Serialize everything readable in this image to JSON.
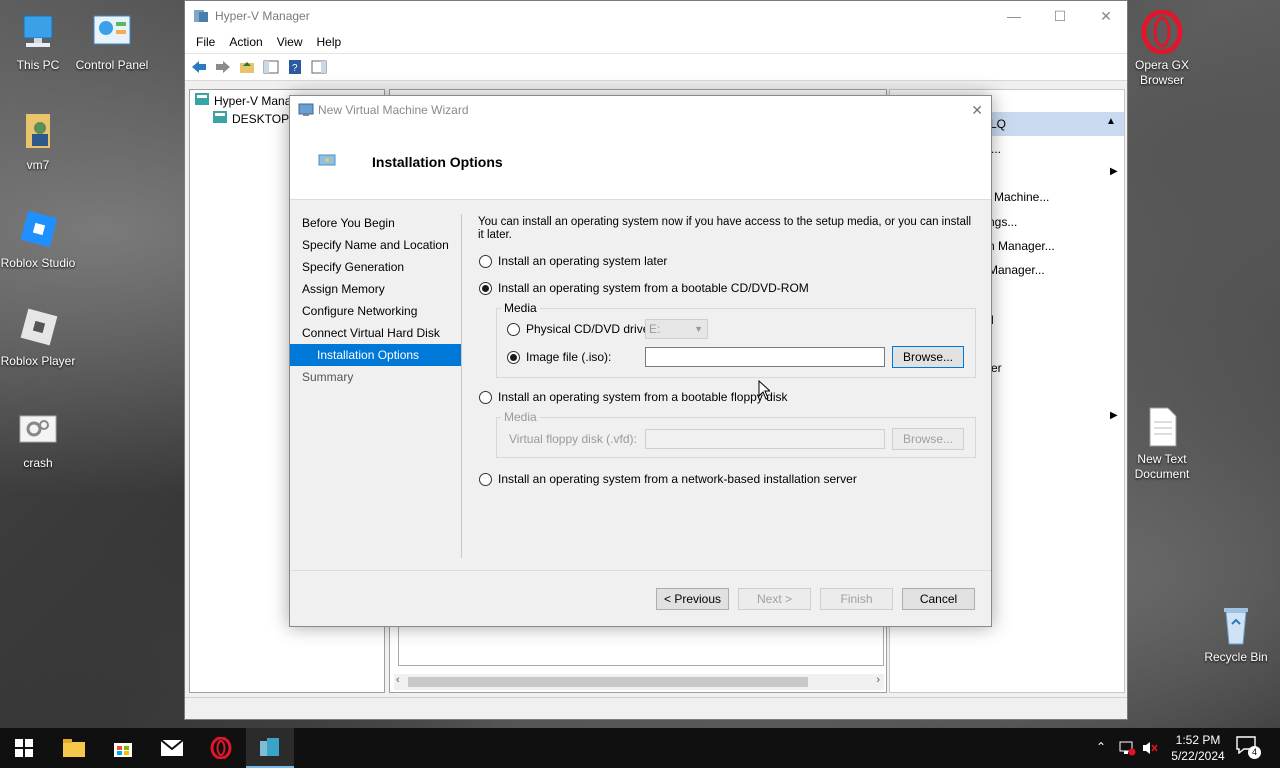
{
  "desktop": {
    "icons_left": [
      {
        "label": "This PC"
      },
      {
        "label": "Control Panel"
      },
      {
        "label": "vm7"
      },
      {
        "label": "Roblox Studio"
      },
      {
        "label": "Roblox Player"
      },
      {
        "label": "crash"
      }
    ],
    "icons_right": [
      {
        "label": "Opera GX Browser"
      },
      {
        "label": "New Text Document"
      },
      {
        "label": "Recycle Bin"
      }
    ]
  },
  "hyperv": {
    "title": "Hyper-V Manager",
    "menu": [
      "File",
      "Action",
      "View",
      "Help"
    ],
    "tree_root": "Hyper-V Mana",
    "tree_child": "DESKTOP-5",
    "actions_header": "LQ",
    "actions_items": [
      "...",
      "l Machine...",
      "ngs...",
      "n Manager...",
      "Manager...",
      "l",
      "er"
    ]
  },
  "wizard": {
    "title": "New Virtual Machine Wizard",
    "heading": "Installation Options",
    "nav": [
      "Before You Begin",
      "Specify Name and Location",
      "Specify Generation",
      "Assign Memory",
      "Configure Networking",
      "Connect Virtual Hard Disk",
      "Installation Options",
      "Summary"
    ],
    "intro": "You can install an operating system now if you have access to the setup media, or you can install it later.",
    "options": {
      "later": "Install an operating system later",
      "cd": "Install an operating system from a bootable CD/DVD-ROM",
      "floppy": "Install an operating system from a bootable floppy disk",
      "network": "Install an operating system from a network-based installation server"
    },
    "selected_option": "cd",
    "media_label": "Media",
    "physical_label": "Physical CD/DVD drive:",
    "physical_drive_value": "E:",
    "image_label": "Image file (.iso):",
    "image_value": "",
    "browse": "Browse...",
    "floppy_media_label": "Media",
    "floppy_label": "Virtual floppy disk (.vfd):",
    "floppy_value": "",
    "buttons": {
      "previous": "< Previous",
      "next": "Next >",
      "finish": "Finish",
      "cancel": "Cancel"
    }
  },
  "taskbar": {
    "time": "1:52 PM",
    "date": "5/22/2024",
    "notification_count": "4"
  },
  "colors": {
    "accent": "#0078d7",
    "taskbar": "#101010"
  }
}
